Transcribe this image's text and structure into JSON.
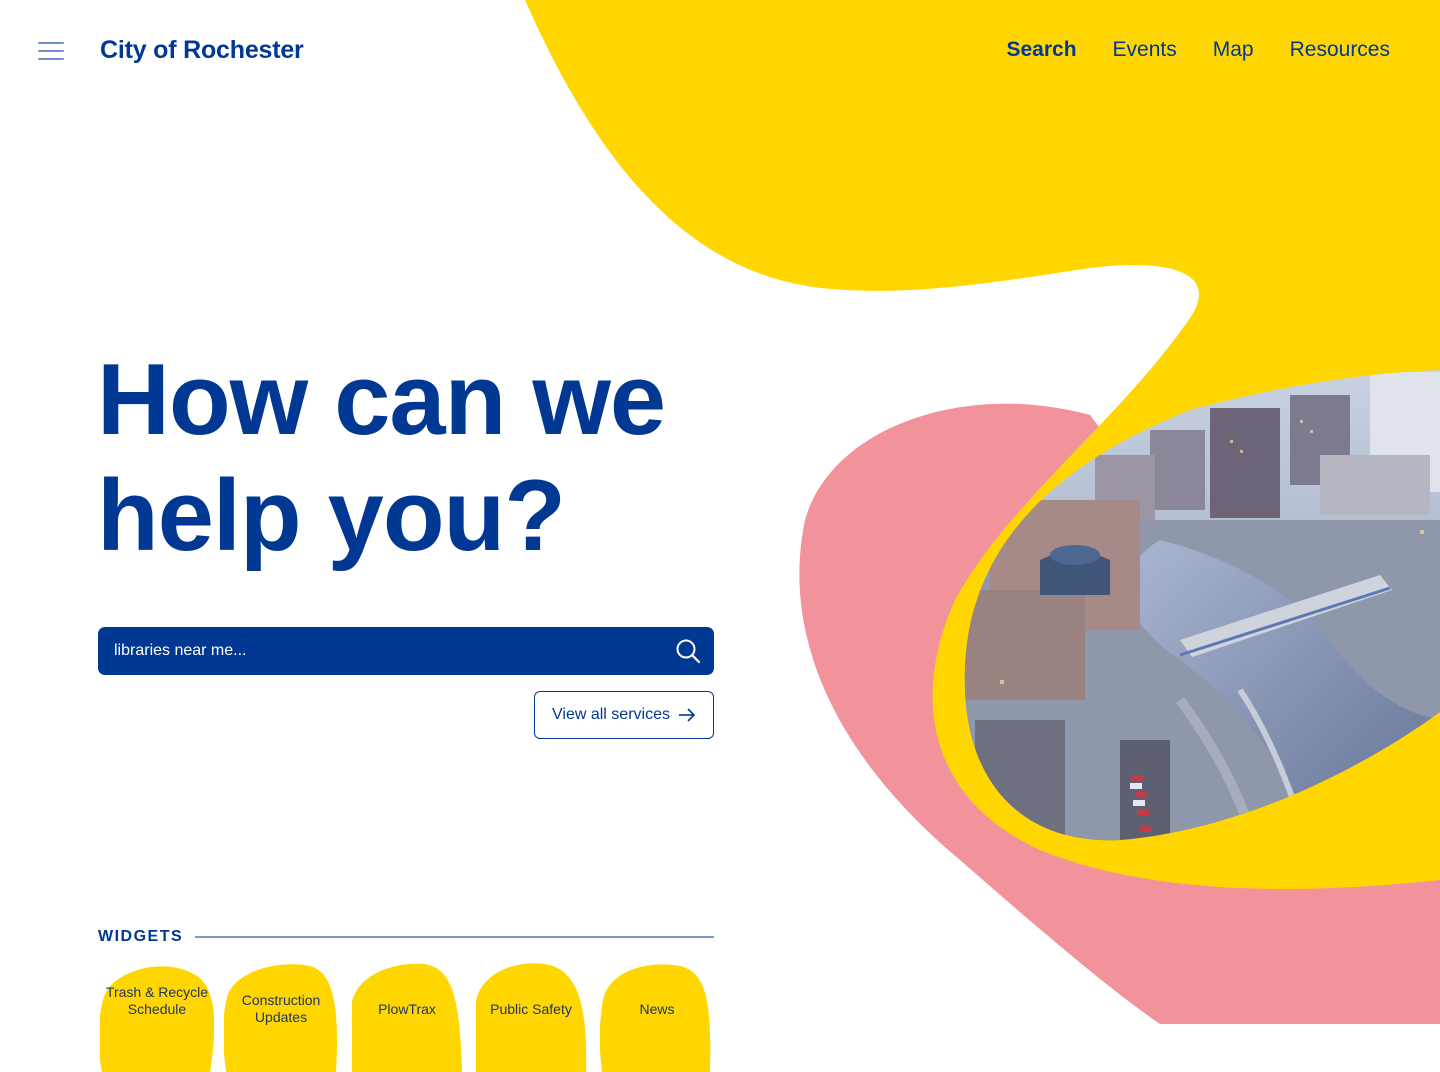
{
  "header": {
    "brand": "City of Rochester",
    "nav": [
      {
        "label": "Search",
        "active": true
      },
      {
        "label": "Events",
        "active": false
      },
      {
        "label": "Map",
        "active": false
      },
      {
        "label": "Resources",
        "active": false
      }
    ]
  },
  "hero": {
    "title_line1": "How can we",
    "title_line2": "help you?"
  },
  "search": {
    "placeholder": "libraries near me..."
  },
  "view_all_label": "View all services",
  "widgets": {
    "heading": "WIDGETS",
    "items": [
      {
        "label": "Trash & Recycle Schedule"
      },
      {
        "label": "Construction Updates"
      },
      {
        "label": "PlowTrax"
      },
      {
        "label": "Public Safety"
      },
      {
        "label": "News"
      }
    ]
  },
  "colors": {
    "primary_blue": "#003893",
    "accent_yellow": "#FFD600",
    "accent_pink": "#F2939C",
    "background": "#FFFFFF"
  },
  "icons": [
    "menu-icon",
    "search-icon",
    "arrow-right-icon"
  ]
}
